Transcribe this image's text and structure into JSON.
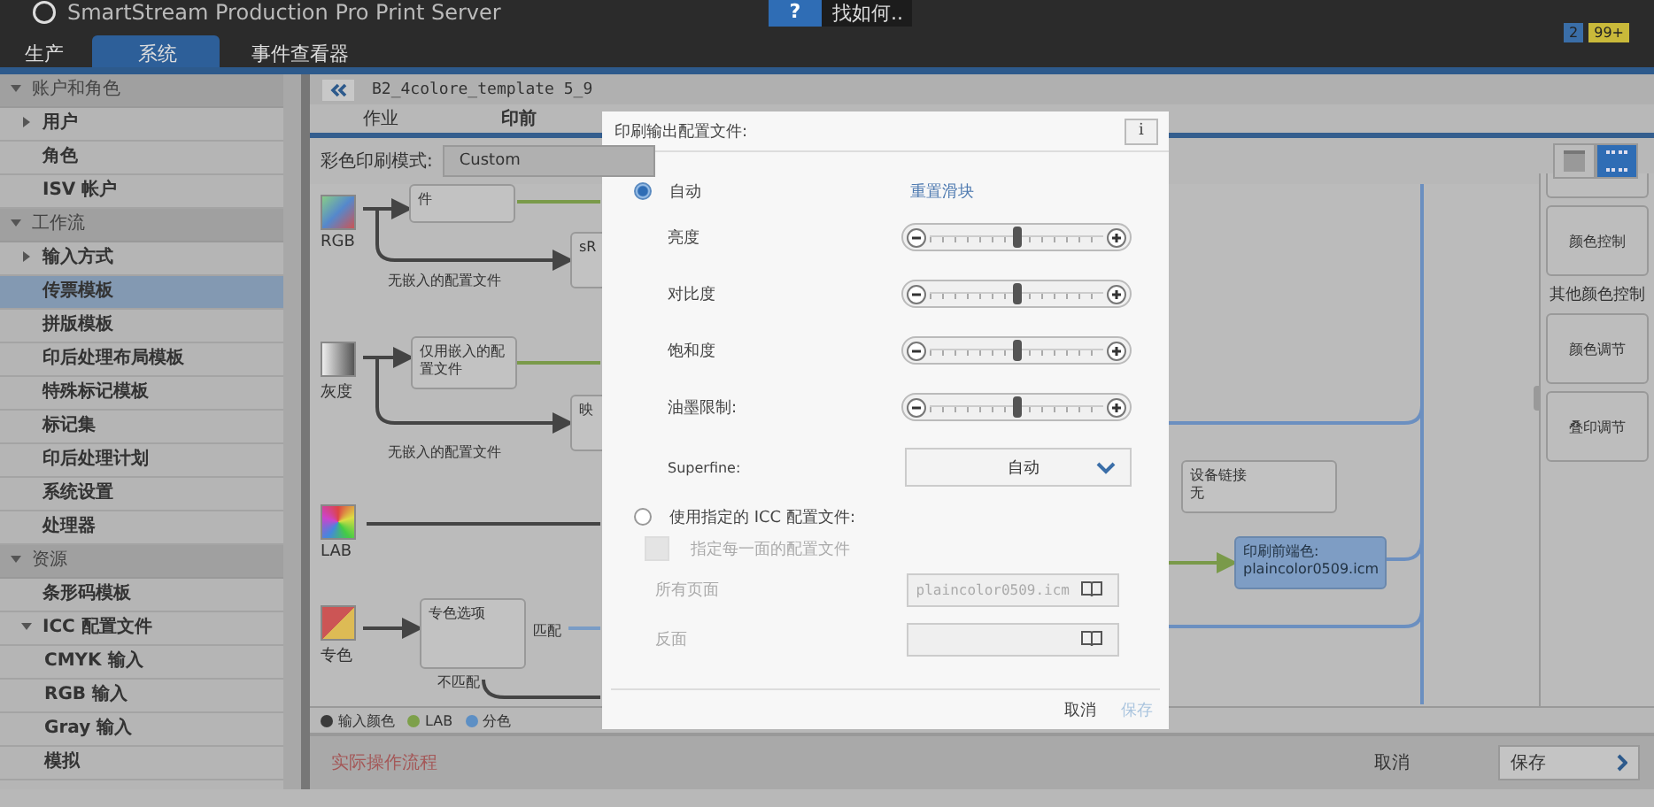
{
  "app": {
    "title": "SmartStream Production Pro Print Server",
    "help": {
      "icon": "?",
      "label": "找如何.."
    },
    "badges": [
      {
        "text": "2",
        "color": "#3a6ea8"
      },
      {
        "text": "99+",
        "color": "#c9b93a"
      }
    ]
  },
  "main_tabs": [
    {
      "label": "生产",
      "selected": false
    },
    {
      "label": "系统",
      "selected": true
    },
    {
      "label": "事件查看器",
      "selected": false
    }
  ],
  "sidebar": {
    "groups": [
      {
        "label": "账户和角色",
        "expanded": true,
        "items": [
          {
            "label": "用户",
            "selected": false,
            "expanded": false
          },
          {
            "label": "角色",
            "selected": false
          },
          {
            "label": "ISV 帐户",
            "selected": false
          }
        ]
      },
      {
        "label": "工作流",
        "expanded": true,
        "items": [
          {
            "label": "输入方式",
            "selected": false,
            "expanded": false
          },
          {
            "label": "传票模板",
            "selected": true
          },
          {
            "label": "拼版模板",
            "selected": false
          },
          {
            "label": "印后处理布局模板",
            "selected": false
          },
          {
            "label": "特殊标记模板",
            "selected": false
          },
          {
            "label": "标记集",
            "selected": false
          },
          {
            "label": "印后处理计划",
            "selected": false
          },
          {
            "label": "系统设置",
            "selected": false
          },
          {
            "label": "处理器",
            "selected": false
          }
        ]
      },
      {
        "label": "资源",
        "expanded": true,
        "items": [
          {
            "label": "条形码模板",
            "selected": false
          },
          {
            "label": "ICC 配置文件",
            "selected": false,
            "expanded": true,
            "children": [
              {
                "label": "CMYK 输入",
                "selected": false
              },
              {
                "label": "RGB 输入",
                "selected": false
              },
              {
                "label": "Gray 输入",
                "selected": false
              },
              {
                "label": "模拟",
                "selected": false
              }
            ]
          }
        ]
      }
    ]
  },
  "template": {
    "name": "B2_4colore_template 5_9",
    "tabs": [
      {
        "label": "作业",
        "selected": false
      },
      {
        "label": "印前",
        "selected": true
      }
    ],
    "mode_label": "彩色印刷模式:",
    "mode_value": "Custom"
  },
  "workflow": {
    "inputs": [
      {
        "label": "RGB",
        "kind": "rgb"
      },
      {
        "label": "灰度",
        "kind": "gray"
      },
      {
        "label": "LAB",
        "kind": "lab"
      },
      {
        "label": "专色",
        "kind": "spot"
      }
    ],
    "nodes": [
      {
        "text": "件",
        "kind": "plain"
      },
      {
        "text": "sR",
        "kind": "plain"
      },
      {
        "text": "仅用嵌入的配置文件",
        "kind": "plain"
      },
      {
        "text": "映",
        "kind": "plain"
      },
      {
        "text": "专色选项",
        "kind": "plain"
      },
      {
        "lines": [
          "设备链接",
          "无"
        ],
        "kind": "plain"
      },
      {
        "lines": [
          "印刷前端色:",
          "plaincolor0509.icm"
        ],
        "kind": "active"
      }
    ],
    "labels": [
      "无嵌入的配置文件",
      "无嵌入的配置文件",
      "匹配",
      "不匹配"
    ],
    "side_buttons": [
      "颜色控制",
      "颜色调节",
      "叠印调节"
    ],
    "side_heading": "其他颜色控制",
    "legend": [
      {
        "label": "输入颜色",
        "color": "#3a3a3a"
      },
      {
        "label": "LAB",
        "color": "#7da04a"
      },
      {
        "label": "分色",
        "color": "#5d8fc4"
      }
    ]
  },
  "footer": {
    "note": "实际操作流程",
    "cancel": "取消",
    "save": "保存"
  },
  "dialog": {
    "title": "印刷输出配置文件:",
    "info": "i",
    "auto": {
      "label": "自动",
      "selected": true,
      "reset": "重置滑块"
    },
    "sliders": [
      {
        "name": "亮度",
        "level": 0.5
      },
      {
        "name": "对比度",
        "level": 0.5
      },
      {
        "name": "饱和度",
        "level": 0.5
      },
      {
        "name": "油墨限制:",
        "level": 0.5
      }
    ],
    "superfine": {
      "label": "Superfine:",
      "value": "自动"
    },
    "icc": {
      "label": "使用指定的 ICC 配置文件:",
      "selected": false,
      "per_side": {
        "label": "指定每一面的配置文件",
        "checked": false,
        "disabled": true
      },
      "fields": [
        {
          "label": "所有页面",
          "value": "plaincolor0509.icm"
        },
        {
          "label": "反面"
        }
      ]
    },
    "cancel": "取消",
    "save": {
      "label": "保存",
      "disabled": true
    }
  }
}
